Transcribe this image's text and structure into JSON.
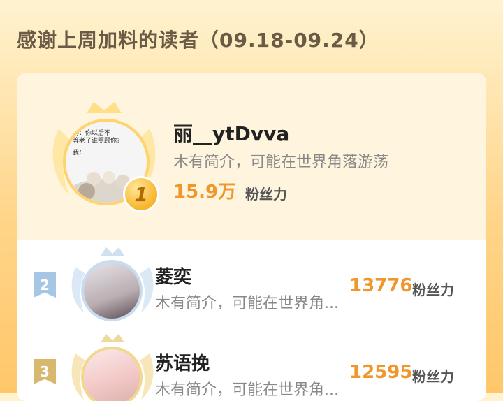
{
  "header": {
    "title": "感谢上周加料的读者（09.18-09.24）"
  },
  "readers": [
    {
      "rank": "1",
      "name": "丽__ytDvva",
      "bio": "木有简介，可能在世界角落游荡",
      "fans": "15.9万",
      "fans_label": "粉丝力",
      "avatar_text_1": "妈：你以后不",
      "avatar_text_2": "等老了谁照顾你?",
      "avatar_text_3": "我：",
      "accent": "#f7b52b"
    },
    {
      "rank": "2",
      "name": "菱奕",
      "bio": "木有简介，可能在世界角...",
      "fans": "13776",
      "fans_label": "粉丝力",
      "accent": "#a6c6e6"
    },
    {
      "rank": "3",
      "name": "苏语挽",
      "bio": "木有简介，可能在世界角...",
      "fans": "12595",
      "fans_label": "粉丝力",
      "accent": "#d8b86e"
    }
  ],
  "colors": {
    "fans_text": "#f0962a",
    "title_text": "#6b5a45"
  }
}
